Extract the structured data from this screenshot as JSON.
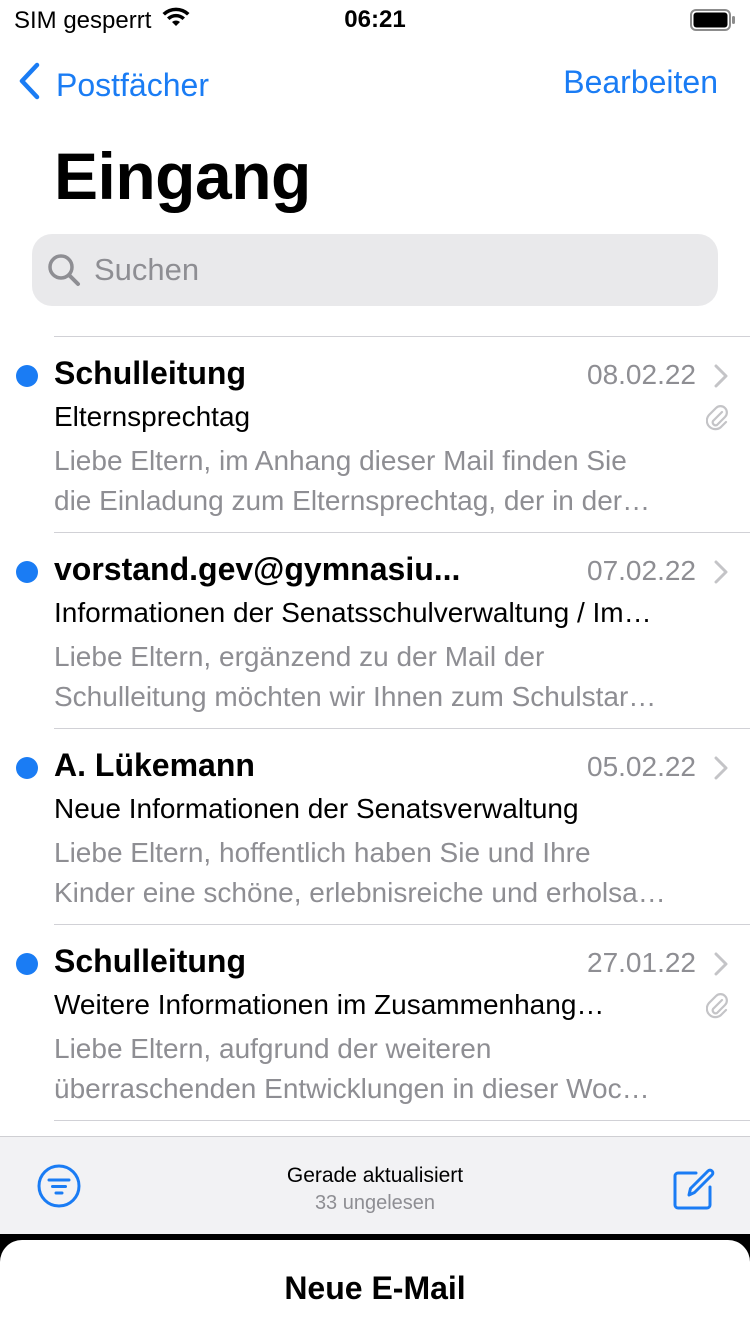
{
  "status_bar": {
    "carrier": "SIM gesperrt",
    "time": "06:21",
    "wifi_icon": "wifi-icon",
    "battery_icon": "battery-icon"
  },
  "nav": {
    "back_label": "Postfächer",
    "edit_label": "Bearbeiten"
  },
  "page": {
    "title": "Eingang"
  },
  "search": {
    "placeholder": "Suchen"
  },
  "mails": [
    {
      "sender": "Schulleitung",
      "date": "08.02.22",
      "subject": "Elternsprechtag",
      "preview_line1": "Liebe Eltern, im Anhang dieser Mail finden Sie",
      "preview_line2": "die Einladung zum Elternsprechtag, der in der…",
      "unread": true,
      "attachment": true
    },
    {
      "sender": "vorstand.gev@gymnasiu...",
      "date": "07.02.22",
      "subject": "Informationen der Senatsschulverwaltung / Im…",
      "preview_line1": "Liebe Eltern, ergänzend zu der Mail der",
      "preview_line2": "Schulleitung möchten wir Ihnen zum Schulstar…",
      "unread": true,
      "attachment": false
    },
    {
      "sender": "A. Lükemann",
      "date": "05.02.22",
      "subject": "Neue Informationen der Senatsverwaltung",
      "preview_line1": "Liebe Eltern, hoffentlich haben Sie und Ihre",
      "preview_line2": "Kinder eine schöne, erlebnisreiche und erholsa…",
      "unread": true,
      "attachment": false
    },
    {
      "sender": "Schulleitung",
      "date": "27.01.22",
      "subject": "Weitere Informationen im Zusammenhang…",
      "preview_line1": "Liebe Eltern, aufgrund der weiteren",
      "preview_line2": "überraschenden Entwicklungen in dieser Woc…",
      "unread": true,
      "attachment": true
    }
  ],
  "toolbar": {
    "status_line1": "Gerade aktualisiert",
    "status_line2": "33 ungelesen"
  },
  "sheet": {
    "title": "Neue E-Mail"
  },
  "colors": {
    "accent": "#1a7cf4",
    "secondary_text": "#8e8e93"
  }
}
